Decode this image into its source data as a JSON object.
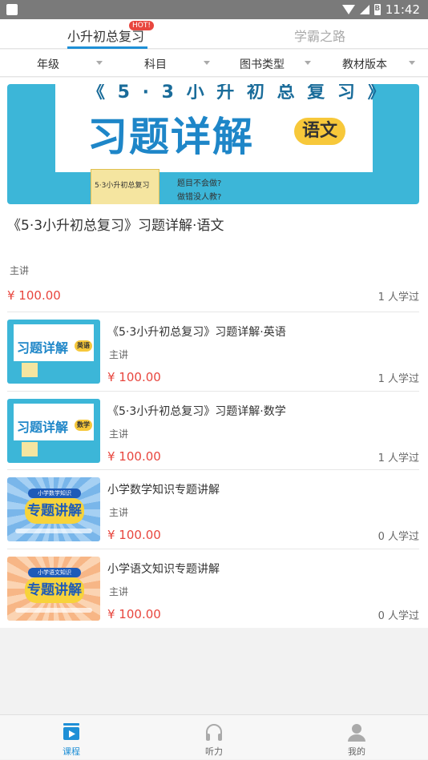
{
  "status_bar": {
    "time": "11:42",
    "battery_glyph": "B"
  },
  "tabs": {
    "course": "小升初总复习",
    "hot": "HOT!",
    "xueba": "学霸之路"
  },
  "filters": [
    "年级",
    "科目",
    "图书类型",
    "教材版本"
  ],
  "banner": {
    "top_line": "《 5 · 3 小 升 初 总 复 习 》",
    "headline": "习题详解",
    "subject_badge": "语文",
    "book_title": "5·3小升初总复习",
    "question_1": "题目不会做?",
    "question_2": "做错没人教?"
  },
  "featured": {
    "title": "《5·3小升初总复习》习题详解·语文",
    "lecturer": "主讲",
    "price": "¥ 100.00",
    "learned": "1 人学过"
  },
  "courses": [
    {
      "title": "《5·3小升初总复习》习题详解·英语",
      "lecturer": "主讲",
      "price": "¥ 100.00",
      "learned": "1 人学过",
      "thumb_text": "习题详解",
      "thumb_badge": "英语"
    },
    {
      "title": "《5·3小升初总复习》习题详解·数学",
      "lecturer": "主讲",
      "price": "¥ 100.00",
      "learned": "1 人学过",
      "thumb_text": "习题详解",
      "thumb_badge": "数学"
    },
    {
      "title": "小学数学知识专题讲解",
      "lecturer": "主讲",
      "price": "¥ 100.00",
      "learned": "0 人学过",
      "thumb_top": "小学数学知识",
      "thumb_text": "专题讲解"
    },
    {
      "title": "小学语文知识专题讲解",
      "lecturer": "主讲",
      "price": "¥ 100.00",
      "learned": "0 人学过",
      "thumb_top": "小学语文知识",
      "thumb_text": "专题讲解"
    }
  ],
  "bottom_nav": {
    "course": "课程",
    "listen": "听力",
    "mine": "我的"
  },
  "colors": {
    "accent": "#1e8fd6",
    "price": "#e8463e",
    "hot": "#e8463e"
  }
}
